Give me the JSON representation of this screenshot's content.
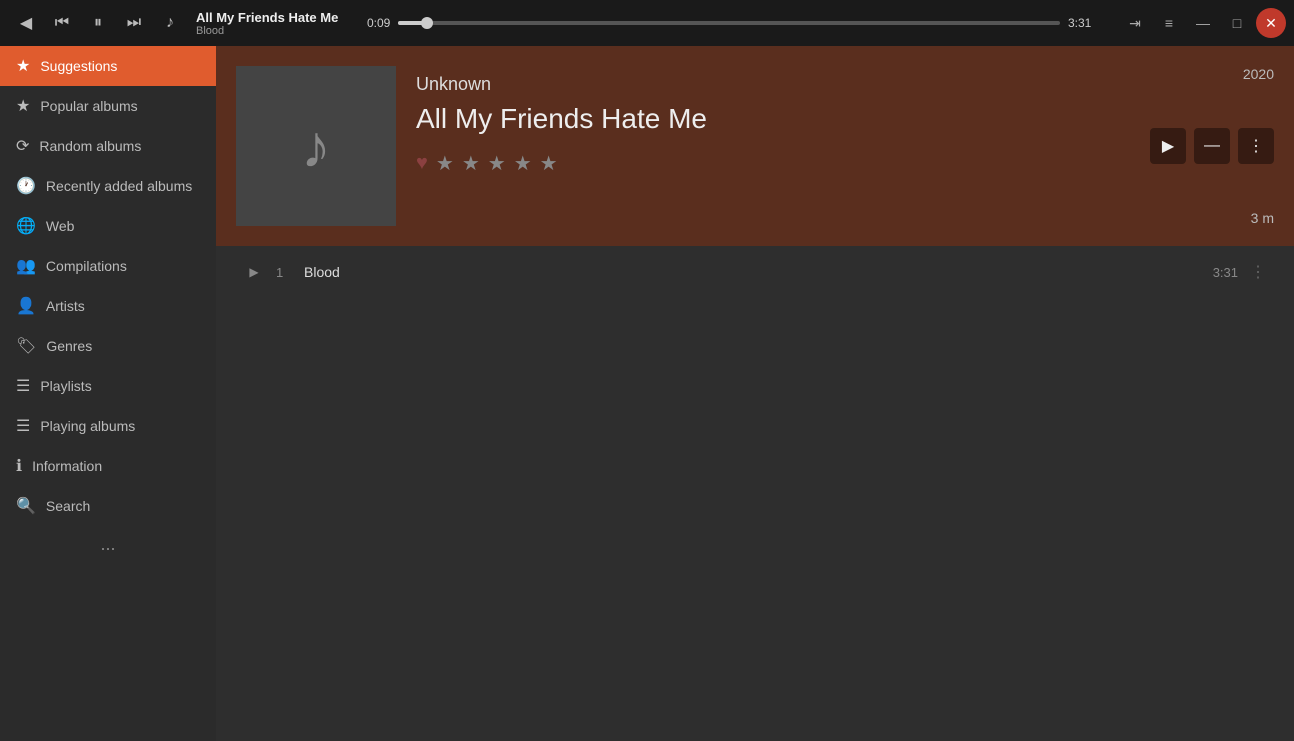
{
  "topbar": {
    "back_icon": "◀",
    "prev_icon": "⏮",
    "pause_icon": "⏸",
    "next_icon": "⏭",
    "music_icon": "♪",
    "track_title": "All My Friends Hate Me",
    "track_subtitle": "Blood",
    "current_time": "0:09",
    "total_time": "3:31",
    "progress_percent": 4.4,
    "queue_icon": "⇥",
    "menu_icon": "≡",
    "minimize_icon": "—",
    "maximize_icon": "□",
    "close_icon": "✕"
  },
  "sidebar": {
    "items": [
      {
        "id": "suggestions",
        "label": "Suggestions",
        "icon": "★",
        "active": true
      },
      {
        "id": "popular-albums",
        "label": "Popular albums",
        "icon": "★"
      },
      {
        "id": "random-albums",
        "label": "Random albums",
        "icon": "⟳"
      },
      {
        "id": "recently-added",
        "label": "Recently added albums",
        "icon": "🕐"
      },
      {
        "id": "web",
        "label": "Web",
        "icon": "🌐"
      },
      {
        "id": "compilations",
        "label": "Compilations",
        "icon": "👤"
      },
      {
        "id": "artists",
        "label": "Artists",
        "icon": "👤"
      },
      {
        "id": "genres",
        "label": "Genres",
        "icon": "🏷"
      },
      {
        "id": "playlists",
        "label": "Playlists",
        "icon": "☰"
      },
      {
        "id": "playing-albums",
        "label": "Playing albums",
        "icon": "☰"
      },
      {
        "id": "information",
        "label": "Information",
        "icon": "ℹ"
      },
      {
        "id": "search",
        "label": "Search",
        "icon": "🔍"
      }
    ],
    "more_label": "..."
  },
  "album": {
    "artist": "Unknown",
    "title": "All My Friends Hate Me",
    "year": "2020",
    "duration_label": "3 m",
    "rating_stars": [
      "★",
      "★",
      "★",
      "★",
      "★"
    ],
    "play_icon": "▶",
    "minus_icon": "—",
    "more_icon": "⋮"
  },
  "tracks": [
    {
      "num": 1,
      "title": "Blood",
      "duration": "3:31"
    }
  ]
}
